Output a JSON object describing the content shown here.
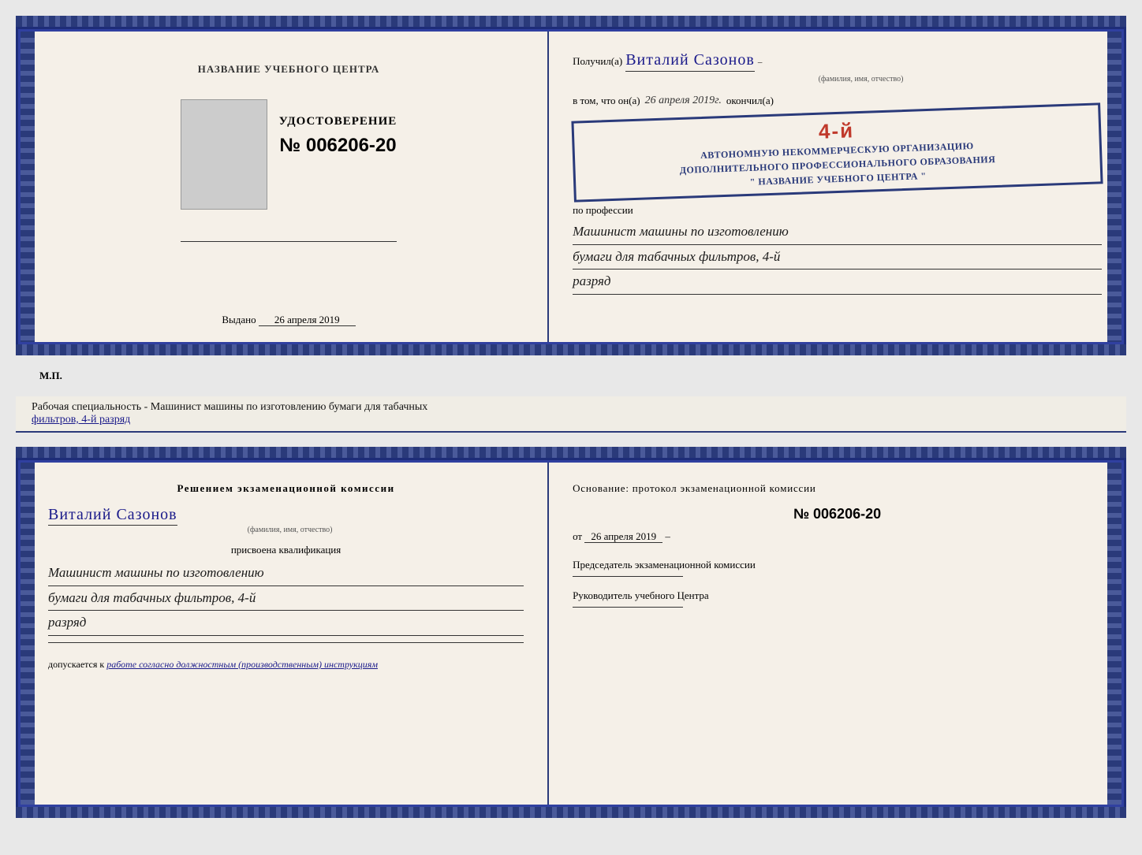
{
  "topCert": {
    "left": {
      "sectionTitle": "НАЗВАНИЕ УЧЕБНОГО ЦЕНТРА",
      "udostoverenie": "УДОСТОВЕРЕНИЕ",
      "number": "№ 006206-20",
      "vydano": "Выдано",
      "vydanoDate": "26 апреля 2019",
      "mp": "М.П."
    },
    "right": {
      "poluchilLabel": "Получил(а)",
      "recipientName": "Виталий Сазонов",
      "recipientSubtitle": "(фамилия, имя, отчество)",
      "dash": "–",
      "vtomChtoLabel": "в том, что он(а)",
      "completionDate": "26 апреля 2019г.",
      "okonchilLabel": "окончил(а)",
      "stampLine1": "АВТОНОМНУЮ НЕКОММЕРЧЕСКУЮ ОРГАНИЗАЦИЮ",
      "stampLine2": "ДОПОЛНИТЕЛЬНОГО ПРОФЕССИОНАЛЬНОГО ОБРАЗОВАНИЯ",
      "stampLine3": "\" НАЗВАНИЕ УЧЕБНОГО ЦЕНТРА \"",
      "stampNumber": "4-й",
      "poProfessii": "по профессии",
      "profession1": "Машинист машины по изготовлению",
      "profession2": "бумаги для табачных фильтров, 4-й",
      "profession3": "разряд"
    }
  },
  "workingSpecialty": {
    "label": "Рабочая специальность - Машинист машины по изготовлению бумаги для табачных",
    "label2": "фильтров, 4-й разряд"
  },
  "bottomCert": {
    "left": {
      "resheniyem": "Решением  экзаменационной  комиссии",
      "personName": "Виталий Сазонов",
      "personSubtitle": "(фамилия, имя, отчество)",
      "prisvoena": "присвоена квалификация",
      "qual1": "Машинист машины по изготовлению",
      "qual2": "бумаги для табачных фильтров, 4-й",
      "qual3": "разряд",
      "dopuskaetsya": "допускается к",
      "dopuskaetsyaText": "работе согласно должностным (производственным) инструкциям"
    },
    "right": {
      "osnovanie": "Основание: протокол экзаменационной  комиссии",
      "number": "№  006206-20",
      "ot": "от",
      "otDate": "26 апреля 2019",
      "predsedatelTitle": "Председатель экзаменационной комиссии",
      "rukovoditelTitle": "Руководитель учебного Центра"
    }
  }
}
